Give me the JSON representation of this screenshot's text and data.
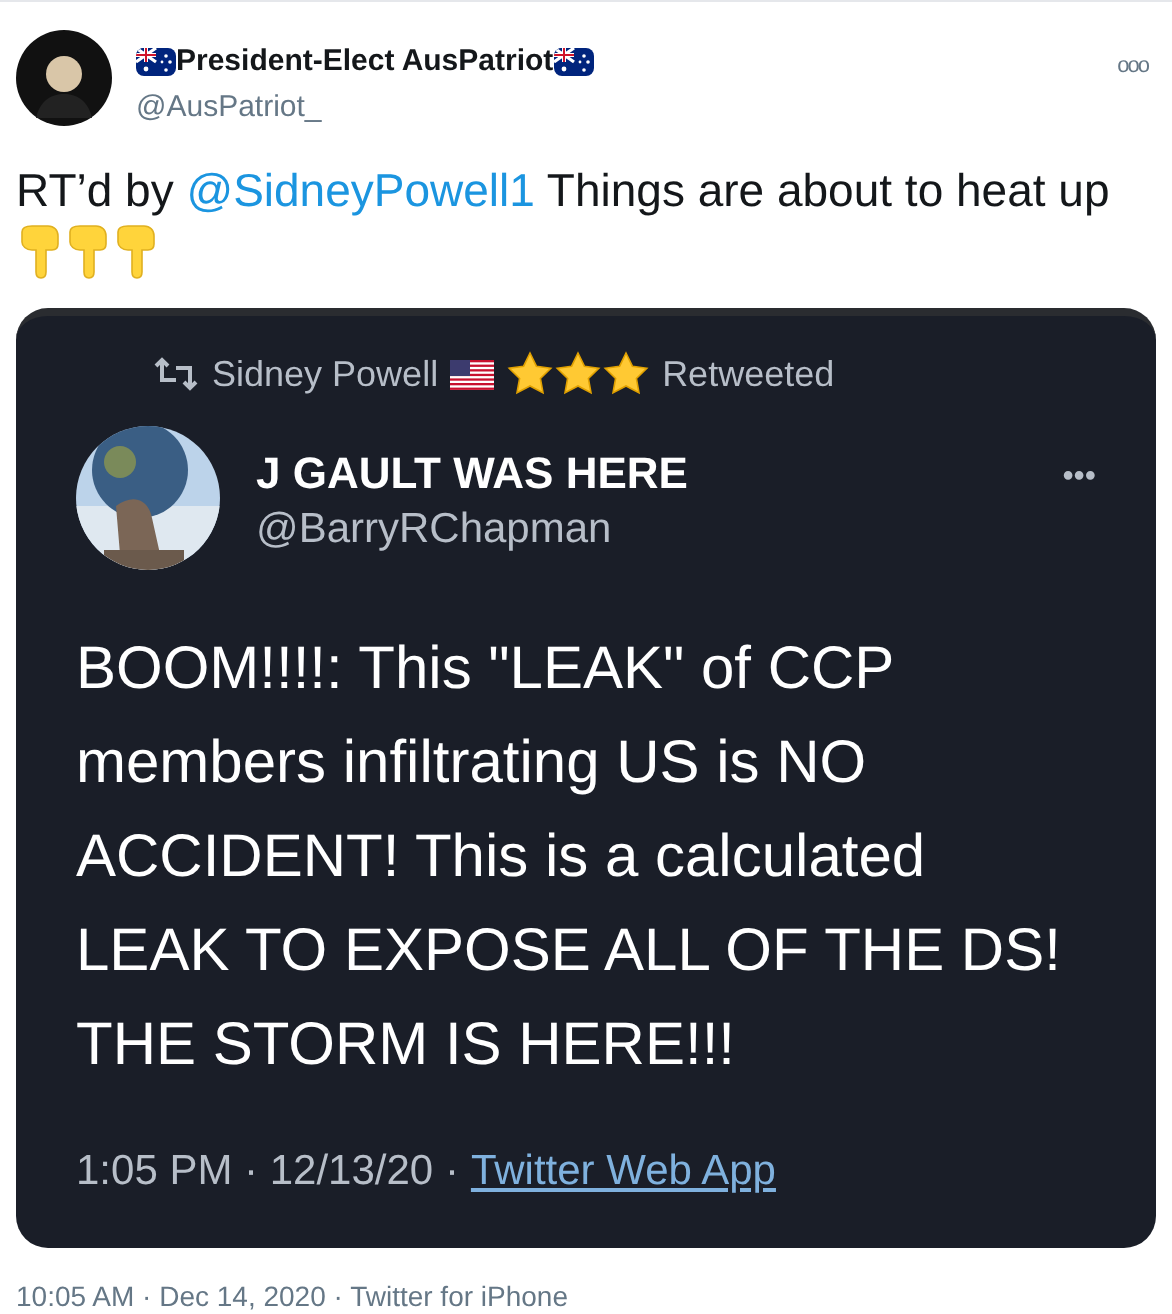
{
  "tweet": {
    "display_name": "President-Elect AusPatriot",
    "handle": "@AusPatriot_",
    "more": "ooo",
    "text_before": "RT’d by",
    "mention": "@SidneyPowell1",
    "text_after": "Things are about to heat up",
    "timestamp": "10:05 AM · Dec 14, 2020 · Twitter for iPhone"
  },
  "embedded_screenshot": {
    "retweet_by": "Sidney Powell",
    "retweet_label": "Retweeted",
    "display_name": "J GAULT WAS HERE",
    "handle": "@BarryRChapman",
    "more": "•••",
    "body": "BOOM!!!!:  This \"LEAK\" of CCP members infiltrating US is NO ACCIDENT! This is a calculated LEAK TO EXPOSE ALL OF THE DS! THE STORM IS HERE!!!",
    "time": "1:05 PM · 12/13/20 ·",
    "source": "Twitter Web App"
  }
}
